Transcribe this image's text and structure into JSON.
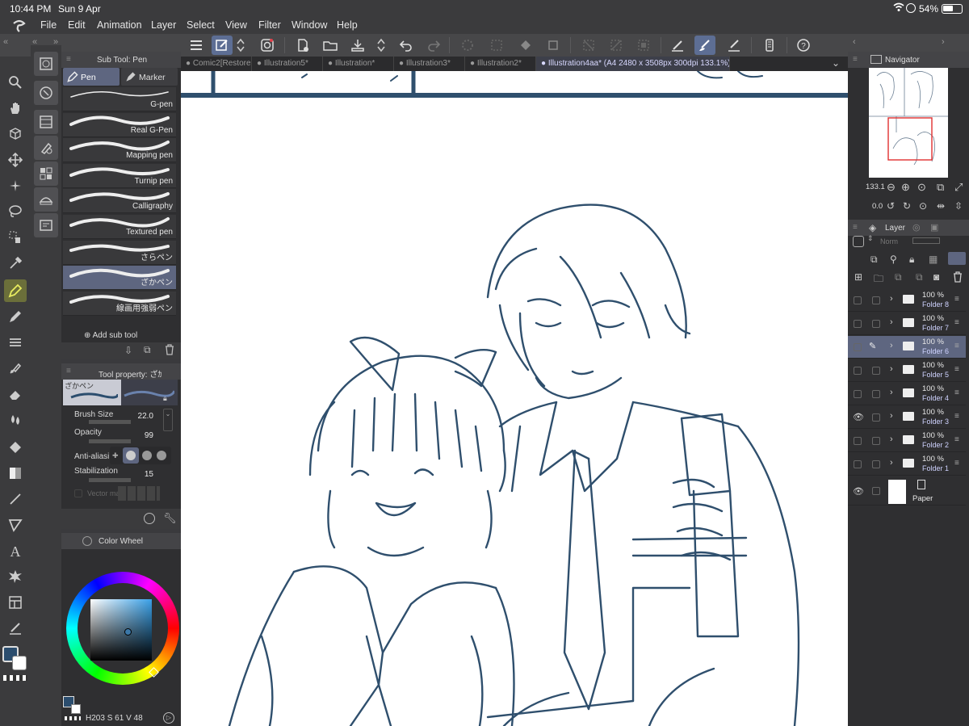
{
  "status": {
    "time": "10:44 PM",
    "date": "Sun 9 Apr",
    "battery": "54%"
  },
  "menu": [
    "File",
    "Edit",
    "Animation",
    "Layer",
    "Select",
    "View",
    "Filter",
    "Window",
    "Help"
  ],
  "tabs": [
    {
      "label": "Comic2[Restore"
    },
    {
      "label": "Illustration5*"
    },
    {
      "label": "Illustration*"
    },
    {
      "label": "Illustration3*"
    },
    {
      "label": "Illustration2*"
    },
    {
      "label": "Illustration4aa* (A4 2480 x 3508px 300dpi 133.1%)"
    }
  ],
  "subtool": {
    "title": "Sub Tool: Pen",
    "tabs": [
      "Pen",
      "Marker"
    ],
    "brushes": [
      "G-pen",
      "Real G-Pen",
      "Mapping pen",
      "Turnip pen",
      "Calligraphy",
      "Textured pen",
      "さらペン",
      "ざかペン",
      "線画用強弱ペン"
    ],
    "add": "Add sub tool"
  },
  "toolprop": {
    "title": "Tool property: ざｶ",
    "brush_name": "ざかペン",
    "brush_size_label": "Brush Size",
    "brush_size": "22.0",
    "opacity_label": "Opacity",
    "opacity": "99",
    "antialias_label": "Anti-aliasing",
    "stabilization_label": "Stabilization",
    "stabilization": "15",
    "vector_label": "Vector ma"
  },
  "colorwheel": {
    "title": "Color Wheel",
    "h": "203",
    "s": "61",
    "v": "48",
    "h_label": "H",
    "s_label": "S",
    "v_label": "V"
  },
  "navigator": {
    "title": "Navigator",
    "zoom": "133.1",
    "rotate": "0.0"
  },
  "layers": {
    "title": "Layer",
    "blend": "Norm",
    "rows": [
      {
        "pct": "100 %",
        "name": "Folder 8"
      },
      {
        "pct": "100 %",
        "name": "Folder 7"
      },
      {
        "pct": "100 %",
        "name": "Folder 6"
      },
      {
        "pct": "100 %",
        "name": "Folder 5"
      },
      {
        "pct": "100 %",
        "name": "Folder 4"
      },
      {
        "pct": "100 %",
        "name": "Folder 3"
      },
      {
        "pct": "100 %",
        "name": "Folder 2"
      },
      {
        "pct": "100 %",
        "name": "Folder 1"
      }
    ],
    "paper": "Paper"
  },
  "colors": {
    "accent": "#5e6680",
    "sketch": "#2f4f6d",
    "main_color": "#2b4d6e"
  }
}
